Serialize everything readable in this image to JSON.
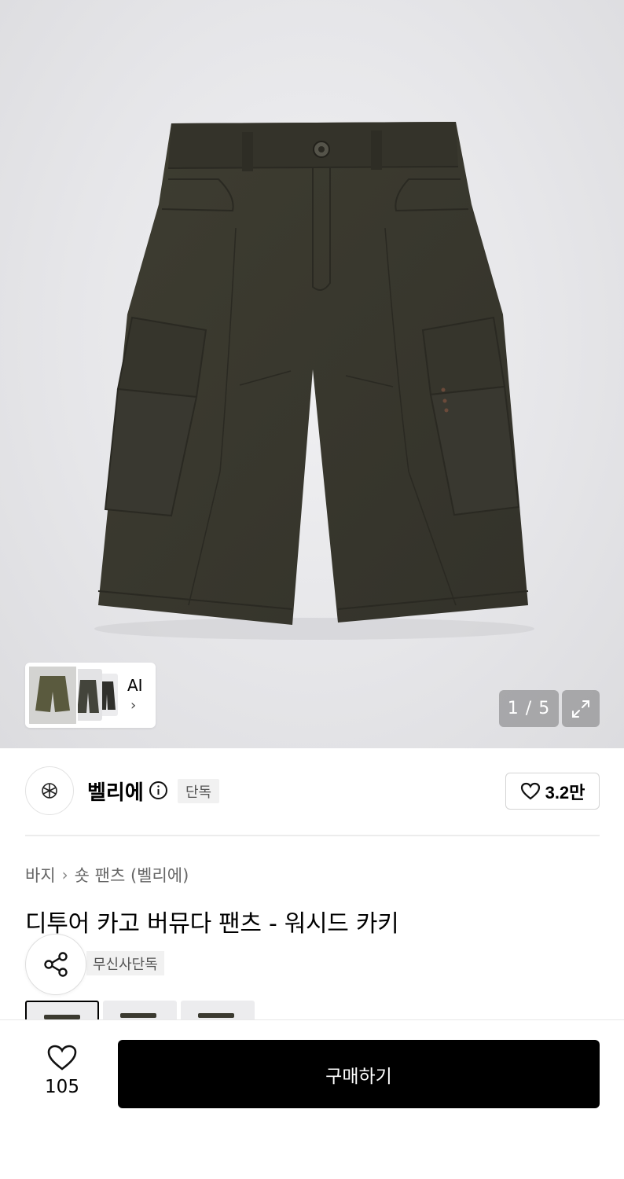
{
  "gallery": {
    "ai_label": "AI",
    "current_page": "1",
    "total_pages": "5",
    "counter_text": "1 / 5"
  },
  "brand": {
    "name": "벨리에",
    "exclusive_badge": "단독",
    "like_count": "3.2만"
  },
  "product": {
    "breadcrumb": [
      "바지",
      "숏 팬츠 (벨리에)"
    ],
    "title": "디투어 카고 버뮤다 팬츠 - 워시드 카키",
    "badge": "무신사단독"
  },
  "bottom_bar": {
    "wish_count": "105",
    "buy_label": "구매하기"
  },
  "colors": {
    "primary_button": "#000000",
    "product_khaki": "#3b3a30"
  }
}
